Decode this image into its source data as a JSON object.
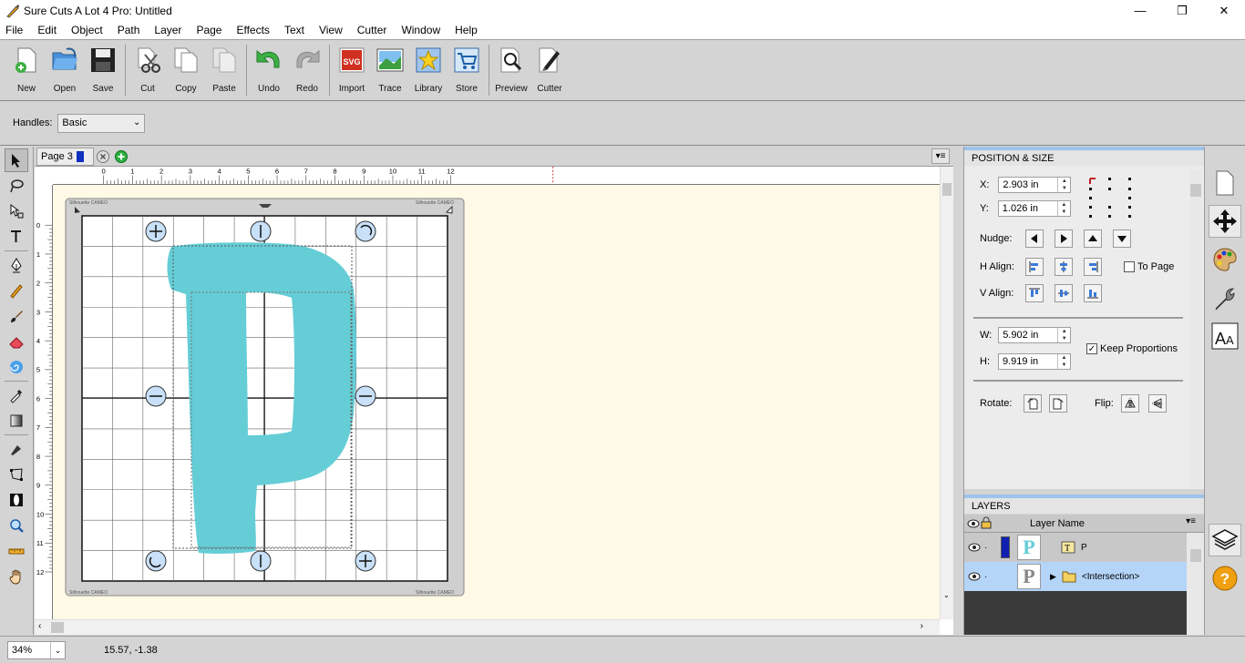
{
  "window": {
    "title": "Sure Cuts A Lot 4 Pro: Untitled",
    "min_glyph": "—",
    "max_glyph": "❐",
    "close_glyph": "✕"
  },
  "menu": [
    "File",
    "Edit",
    "Object",
    "Path",
    "Layer",
    "Page",
    "Effects",
    "Text",
    "View",
    "Cutter",
    "Window",
    "Help"
  ],
  "toolbar": {
    "new": "New",
    "open": "Open",
    "save": "Save",
    "cut": "Cut",
    "copy": "Copy",
    "paste": "Paste",
    "undo": "Undo",
    "redo": "Redo",
    "import": "Import",
    "trace": "Trace",
    "library": "Library",
    "store": "Store",
    "preview": "Preview",
    "cutter": "Cutter"
  },
  "handles": {
    "label": "Handles:",
    "value": "Basic"
  },
  "pages": {
    "tab_label": "Page 3",
    "swatch_color": "#1030c0"
  },
  "ruler": {
    "h_ticks": [
      "0",
      "1",
      "2",
      "3",
      "4",
      "5",
      "6",
      "7",
      "8",
      "9",
      "10",
      "11",
      "12"
    ],
    "v_ticks": [
      "0",
      "1",
      "2",
      "3",
      "4",
      "5",
      "6",
      "7",
      "8",
      "9",
      "10",
      "11",
      "12"
    ]
  },
  "mat": {
    "corner_text": "Silhouette CAMEO"
  },
  "shape": {
    "fill_color": "#65cdd6"
  },
  "position_size": {
    "header": "POSITION & SIZE",
    "x_label": "X:",
    "x_value": "2.903 in",
    "y_label": "Y:",
    "y_value": "1.026 in",
    "nudge_label": "Nudge:",
    "halign_label": "H Align:",
    "valign_label": "V Align:",
    "to_page_label": "To Page",
    "w_label": "W:",
    "w_value": "5.902 in",
    "h_label": "H:",
    "h_value": "9.919 in",
    "keep_proportions_label": "Keep Proportions",
    "keep_proportions_checked": "✓",
    "rotate_label": "Rotate:",
    "flip_label": "Flip:"
  },
  "layers": {
    "header": "LAYERS",
    "col_name": "Layer Name",
    "items": [
      {
        "name": "P"
      },
      {
        "name": "<Intersection>"
      }
    ]
  },
  "status": {
    "zoom": "34%",
    "coords": "15.57, -1.38"
  }
}
